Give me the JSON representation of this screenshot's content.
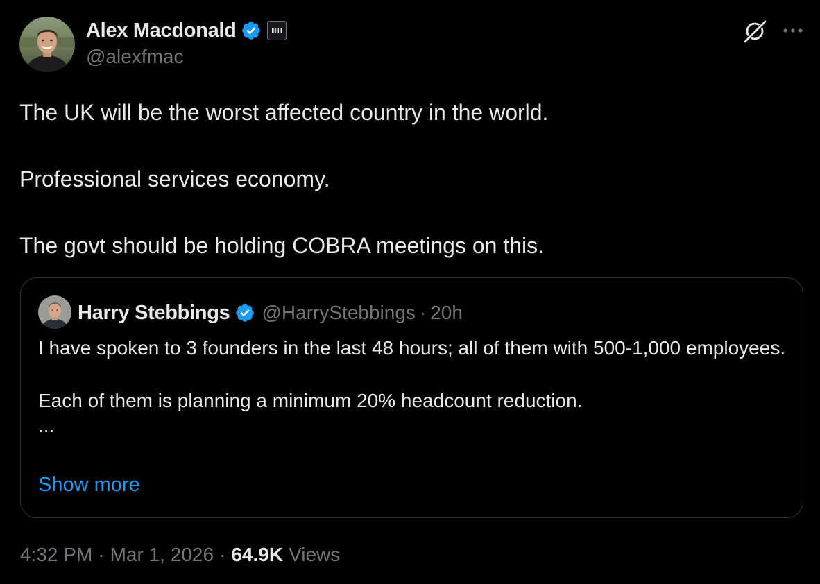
{
  "author": {
    "name": "Alex Macdonald",
    "handle": "@alexfmac"
  },
  "tweet": {
    "paragraphs": [
      "The UK will be the worst affected country in the world.",
      "Professional services economy.",
      "The govt should be holding COBRA meetings on this."
    ]
  },
  "quote": {
    "author_name": "Harry Stebbings",
    "handle": "@HarryStebbings",
    "separator": "·",
    "time": "20h",
    "lines": [
      "I have spoken to 3 founders in the last 48 hours; all of them with 500-1,000 employees.",
      "Each of them is planning a minimum 20% headcount reduction.",
      "..."
    ],
    "show_more": "Show more"
  },
  "meta": {
    "time": "4:32 PM",
    "dot1": "·",
    "date": "Mar 1, 2026",
    "dot2": "·",
    "views_count": "64.9K",
    "views_label": "Views"
  },
  "icons": {
    "verified": "verified-badge-icon",
    "affiliate": "affiliate-badge-icon",
    "grok": "grok-icon",
    "more": "more-horizontal-icon"
  },
  "colors": {
    "background": "#000000",
    "text": "#e7e9ea",
    "secondary": "#71767b",
    "link": "#1d9bf0",
    "verified": "#1d9bf0",
    "border": "#2f3336"
  }
}
